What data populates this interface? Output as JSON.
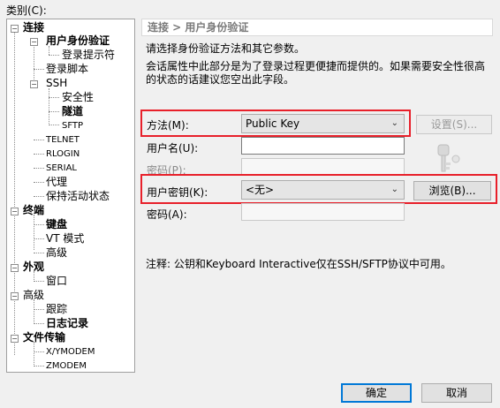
{
  "category_label": "类别(C):",
  "tree": [
    {
      "label": "连接",
      "bold": true
    },
    {
      "label": "用户身份验证",
      "bold": true,
      "selected": true
    },
    {
      "label": "登录提示符"
    },
    {
      "label": "登录脚本"
    },
    {
      "label": "SSH"
    },
    {
      "label": "安全性"
    },
    {
      "label": "隧道",
      "bold": true
    },
    {
      "label": "SFTP",
      "small": true
    },
    {
      "label": "TELNET",
      "small": true
    },
    {
      "label": "RLOGIN",
      "small": true
    },
    {
      "label": "SERIAL",
      "small": true
    },
    {
      "label": "代理"
    },
    {
      "label": "保持活动状态"
    },
    {
      "label": "终端",
      "bold": true
    },
    {
      "label": "键盘",
      "bold": true
    },
    {
      "label": "VT 模式"
    },
    {
      "label": "高级"
    },
    {
      "label": "外观",
      "bold": true
    },
    {
      "label": "窗口"
    },
    {
      "label": "高级"
    },
    {
      "label": "跟踪"
    },
    {
      "label": "日志记录",
      "bold": true
    },
    {
      "label": "文件传输",
      "bold": true
    },
    {
      "label": "X/YMODEM",
      "small": true
    },
    {
      "label": "ZMODEM",
      "small": true
    }
  ],
  "panel": {
    "breadcrumb": "连接 > 用户身份验证",
    "intro": "请选择身份验证方法和其它参数。",
    "note_line1": "会话属性中此部分是为了登录过程更便捷而提供的。如果需要安全性很高",
    "note_line2": "的状态的话建议您空出此字段。",
    "method_label": "方法(M):",
    "method_value": "Public Key",
    "settings_button": "设置(S)...",
    "username_label": "用户名(U):",
    "username_value": "",
    "password_label": "密码(P):",
    "userkey_label": "用户密钥(K):",
    "userkey_value": "<无>",
    "browse_button": "浏览(B)...",
    "passphrase_label": "密码(A):",
    "footnote": "注释: 公钥和Keyboard Interactive仅在SSH/SFTP协议中可用。"
  },
  "buttons": {
    "ok": "确定",
    "cancel": "取消"
  }
}
